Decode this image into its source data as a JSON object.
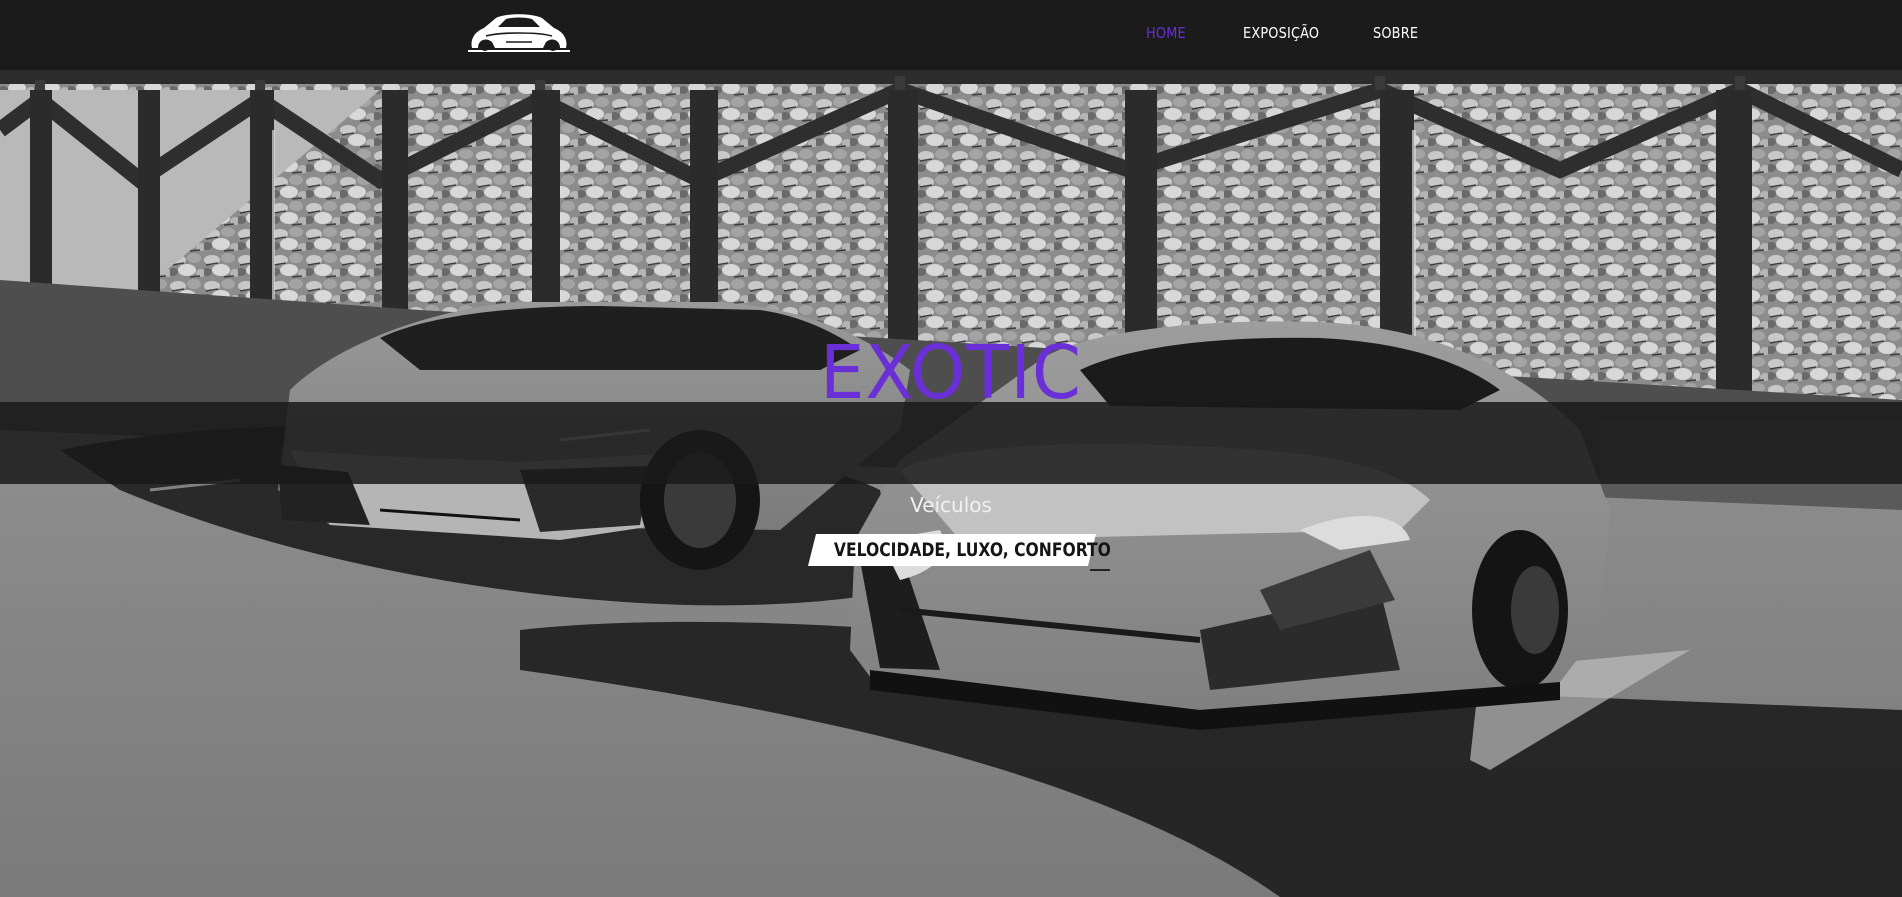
{
  "navbar": {
    "logo_icon": "sports-car-icon",
    "links": [
      {
        "label": "HOME",
        "active": true
      },
      {
        "label": "EXPOSIÇÃO",
        "active": false
      },
      {
        "label": "SOBRE",
        "active": false
      }
    ]
  },
  "hero": {
    "title": "EXOTIC",
    "subtitle": "Veículos",
    "tagline": "VELOCIDADE, LUXO, CONFORTO",
    "background_description": "",
    "background_icon": "sports-cars-photo"
  },
  "colors": {
    "accent": "#6a2fd6",
    "navbar_bg": "#1b1b1b",
    "text_light": "#ffffff",
    "band_bg": "#1a1a1a"
  }
}
